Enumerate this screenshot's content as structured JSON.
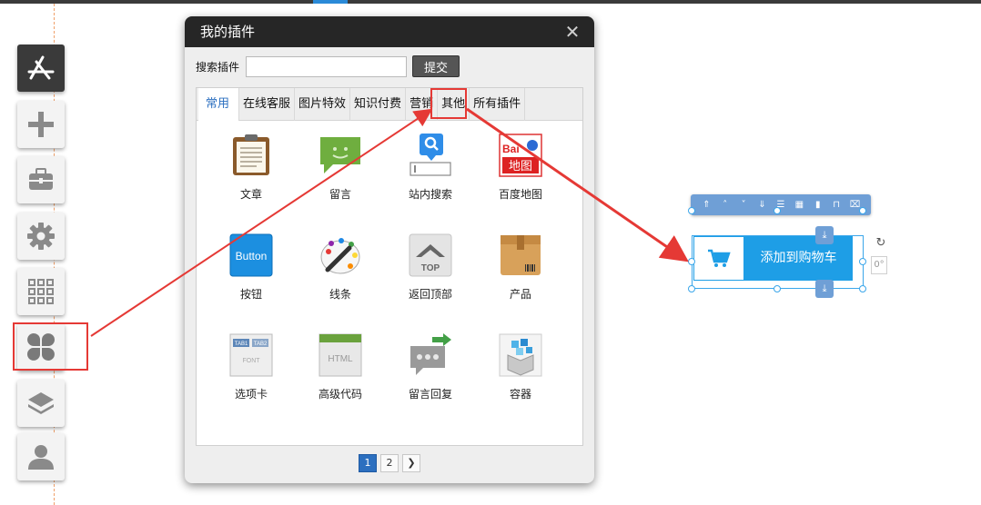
{
  "dialog": {
    "title": "我的插件",
    "close_icon": "close-icon",
    "search": {
      "label": "搜索插件",
      "value": "",
      "placeholder": "",
      "submit_label": "提交"
    }
  },
  "tabs": [
    {
      "label": "常用",
      "active": true
    },
    {
      "label": "在线客服",
      "active": false
    },
    {
      "label": "图片特效",
      "active": false
    },
    {
      "label": "知识付费",
      "active": false
    },
    {
      "label": "营销",
      "active": false,
      "highlighted": true
    },
    {
      "label": "其他",
      "active": false
    },
    {
      "label": "所有插件",
      "active": false
    }
  ],
  "plugins": [
    {
      "label": "文章",
      "icon": "clipboard-document-icon"
    },
    {
      "label": "留言",
      "icon": "chat-bubble-icon"
    },
    {
      "label": "站内搜索",
      "icon": "search-box-icon"
    },
    {
      "label": "百度地图",
      "icon": "baidu-map-icon",
      "icon_text_top": "Bai",
      "icon_text_bottom": "地图"
    },
    {
      "label": "按钮",
      "icon": "button-icon",
      "icon_text": "Button"
    },
    {
      "label": "线条",
      "icon": "palette-pencil-icon"
    },
    {
      "label": "返回顶部",
      "icon": "back-to-top-icon",
      "icon_text": "TOP"
    },
    {
      "label": "产品",
      "icon": "product-box-icon"
    },
    {
      "label": "选项卡",
      "icon": "tabs-icon",
      "icon_text_a": "TAB1",
      "icon_text_b": "TAB2",
      "icon_text_c": "FONT"
    },
    {
      "label": "高级代码",
      "icon": "html-code-icon",
      "icon_text": "HTML"
    },
    {
      "label": "留言回复",
      "icon": "reply-bubble-icon"
    },
    {
      "label": "容器",
      "icon": "container-cubes-icon"
    }
  ],
  "pagination": {
    "pages": [
      "1",
      "2"
    ],
    "current": "1",
    "next_icon": "chevron-right-icon"
  },
  "left_toolbar": [
    {
      "name": "app-store-icon",
      "active": true
    },
    {
      "name": "plus-icon"
    },
    {
      "name": "toolbox-icon"
    },
    {
      "name": "gear-icon"
    },
    {
      "name": "grid-icon"
    },
    {
      "name": "plugin-clover-icon",
      "highlighted": true
    },
    {
      "name": "layers-icon"
    },
    {
      "name": "user-icon"
    }
  ],
  "widget": {
    "button_text": "添加到购物车",
    "cart_icon": "cart-icon",
    "rotation_value": "0°",
    "toolbar_icons": [
      "double-up-icon",
      "up-icon",
      "down-icon",
      "double-down-icon",
      "align-icon",
      "distribute-icon",
      "chart-icon",
      "unlock-icon",
      "trash-icon"
    ]
  },
  "colors": {
    "accent": "#1e9ee6",
    "highlight_red": "#e53935",
    "dialog_header": "#262626",
    "active_tab_text": "#2b6fc0"
  }
}
